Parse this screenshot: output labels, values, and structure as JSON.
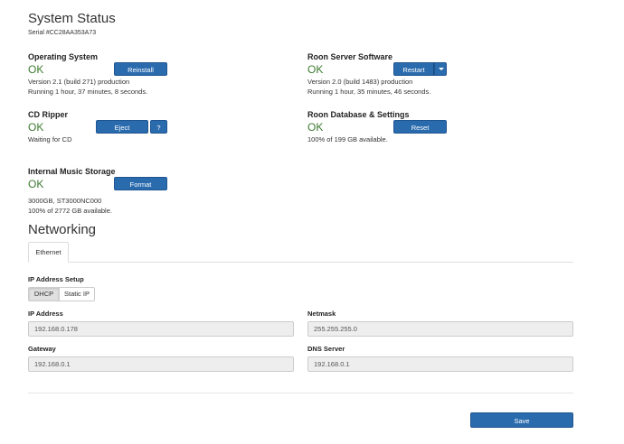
{
  "title": "System Status",
  "serial": "Serial #CC28AA353A73",
  "os": {
    "title": "Operating System",
    "status": "OK",
    "button": "Reinstall",
    "line1": "Version 2.1 (build 271) production",
    "line2": "Running 1 hour, 37 minutes, 8 seconds."
  },
  "server": {
    "title": "Roon Server Software",
    "status": "OK",
    "button": "Restart",
    "line1": "Version 2.0 (build 1483) production",
    "line2": "Running 1 hour, 35 minutes, 46 seconds."
  },
  "cd": {
    "title": "CD Ripper",
    "status": "OK",
    "button": "Eject",
    "help": "?",
    "line1": "Waiting for CD"
  },
  "database": {
    "title": "Roon Database & Settings",
    "status": "OK",
    "button": "Reset",
    "line1": "100% of 199 GB available."
  },
  "storage": {
    "title": "Internal Music Storage",
    "status": "OK",
    "button": "Format",
    "line1": "3000GB, ST3000NC000",
    "line2": "100% of 2772 GB available."
  },
  "networking": {
    "title": "Networking",
    "tab": "Ethernet",
    "ip_setup_label": "IP Address Setup",
    "dhcp": "DHCP",
    "static": "Static IP",
    "selected_mode": "DHCP",
    "ip_label": "IP Address",
    "ip_value": "192.168.0.178",
    "netmask_label": "Netmask",
    "netmask_value": "255.255.255.0",
    "gateway_label": "Gateway",
    "gateway_value": "192.168.0.1",
    "dns_label": "DNS Server",
    "dns_value": "192.168.0.1"
  },
  "save": "Save",
  "colors": {
    "ok": "#3c7a2f",
    "button": "#2a6bae"
  }
}
